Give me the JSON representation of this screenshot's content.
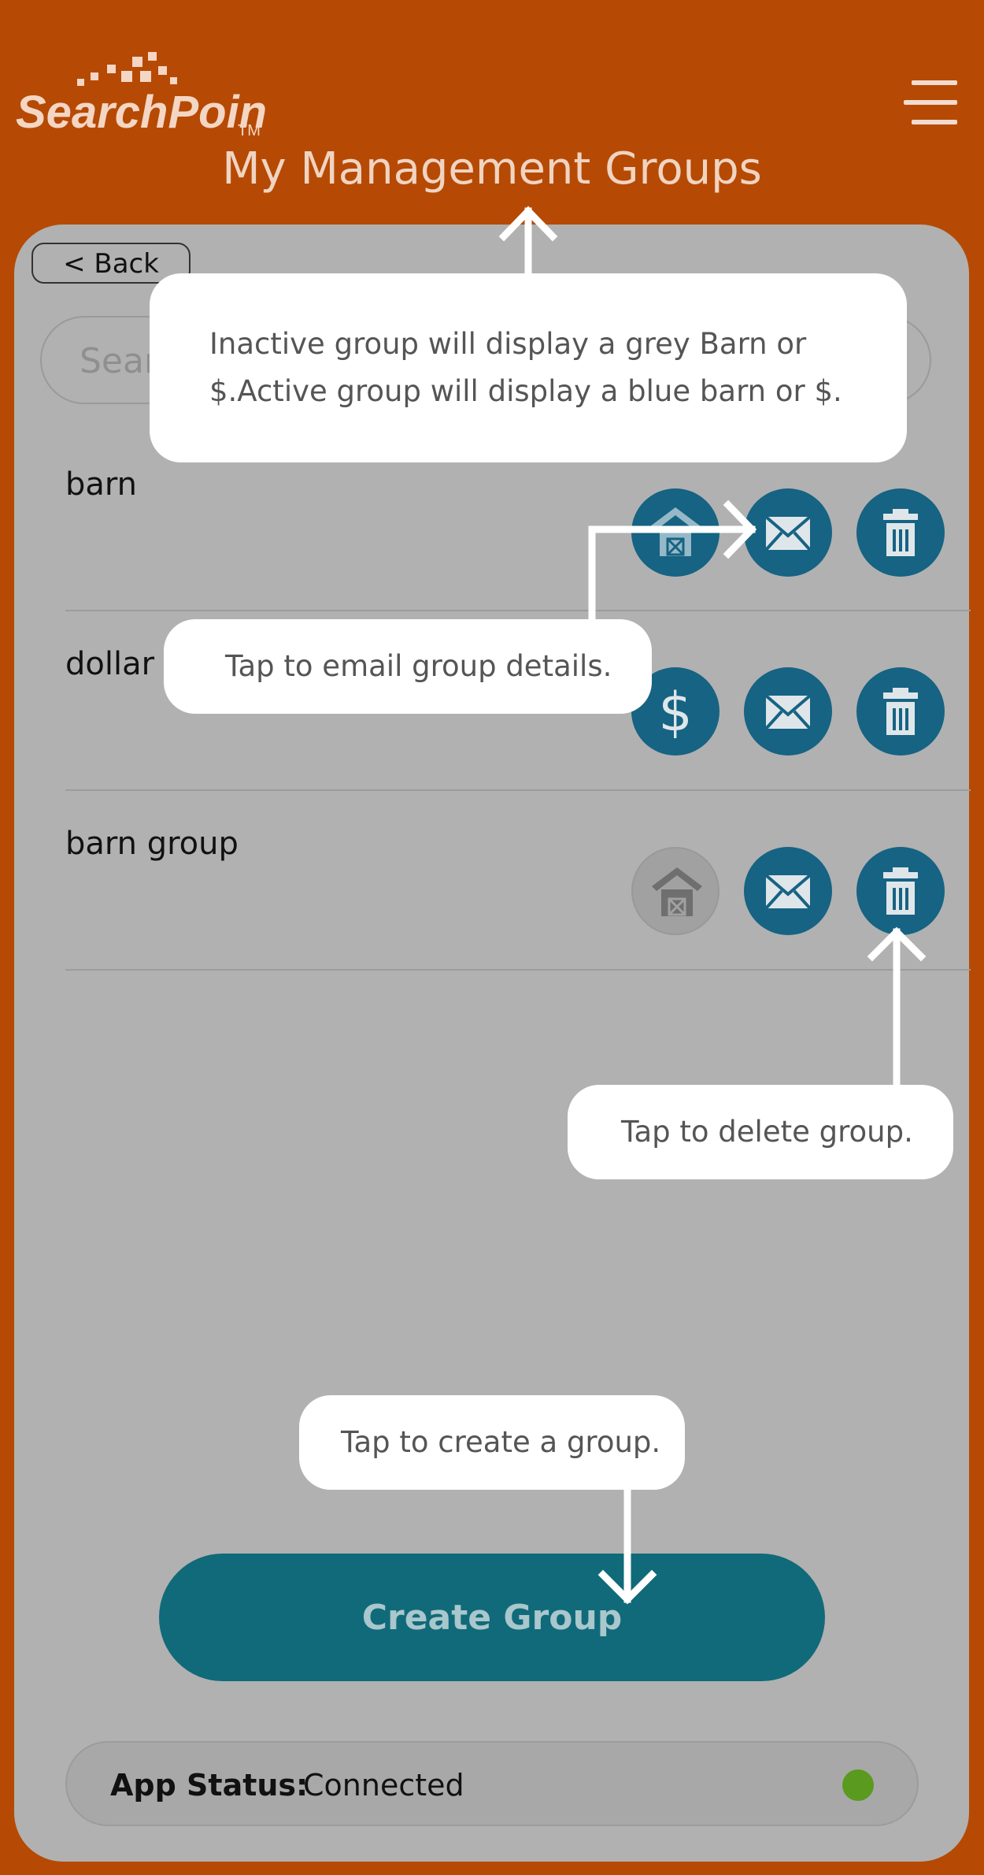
{
  "header": {
    "logo_text": "SearchPoint",
    "logo_tm": "TM",
    "title": "My Management Groups"
  },
  "back_label": "< Back",
  "search": {
    "placeholder": "Search"
  },
  "groups": [
    {
      "name": "barn",
      "type_icon": "barn-icon",
      "active": true
    },
    {
      "name": "dollar",
      "type_icon": "dollar-icon",
      "active": true
    },
    {
      "name": "barn group",
      "type_icon": "barn-icon",
      "active": false
    }
  ],
  "callouts": {
    "inactive_line1": "Inactive group will display a grey Barn or",
    "inactive_line2": "$.Active group will display a blue barn or $.",
    "email": "Tap to email group details.",
    "delete": "Tap to delete group.",
    "create": "Tap to create a group."
  },
  "create_button_label": "Create Group",
  "status": {
    "label": "App Status:",
    "value": "Connected"
  },
  "colors": {
    "brand_orange": "#b64a04",
    "panel_grey": "#b1b1b1",
    "icon_blue": "#166383",
    "create_teal": "#106a79",
    "status_green": "#5a9a1e"
  }
}
